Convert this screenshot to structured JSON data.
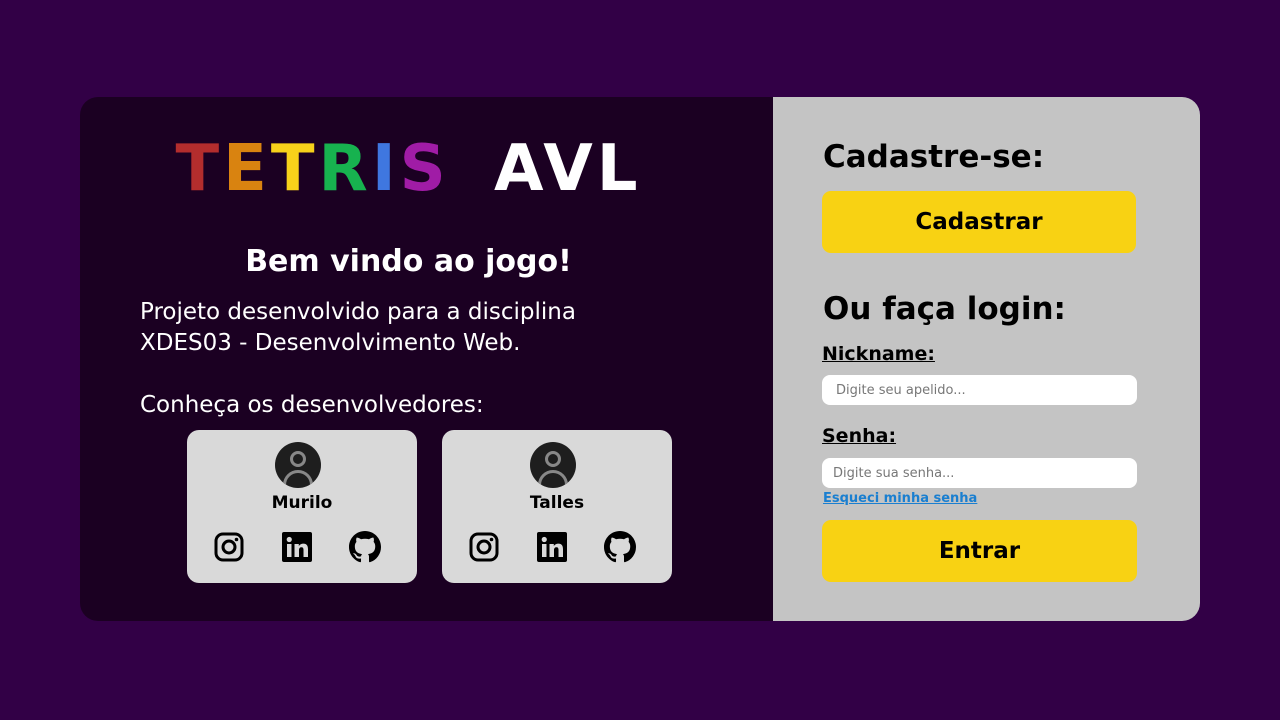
{
  "logo": {
    "letters": [
      {
        "char": "T",
        "color": "#b32d2d"
      },
      {
        "char": "E",
        "color": "#d98310"
      },
      {
        "char": "T",
        "color": "#f7d11a"
      },
      {
        "char": "R",
        "color": "#17b24f"
      },
      {
        "char": "I",
        "color": "#3f77e0"
      },
      {
        "char": "S",
        "color": "#a01ca6"
      }
    ],
    "suffix": "AVL",
    "suffix_color": "#ffffff"
  },
  "welcome": "Bem vindo ao jogo!",
  "description_line1": "Projeto desenvolvido para a disciplina",
  "description_line2": "XDES03 - Desenvolvimento Web.",
  "developers_title": "Conheça os desenvolvedores:",
  "developers": [
    {
      "name": "Murilo",
      "icons": [
        "instagram-icon",
        "linkedin-icon",
        "github-icon"
      ]
    },
    {
      "name": "Talles",
      "icons": [
        "instagram-icon",
        "linkedin-icon",
        "github-icon"
      ]
    }
  ],
  "signup": {
    "title": "Cadastre-se:",
    "button_label": "Cadastrar"
  },
  "login": {
    "title": "Ou faça login:",
    "nickname_label": "Nickname:",
    "nickname_placeholder": "Digite seu apelido...",
    "password_label": "Senha:",
    "password_placeholder": "Digite sua senha...",
    "forgot_link": "Esqueci minha senha",
    "submit_label": "Entrar"
  },
  "colors": {
    "page_bg": "#320046",
    "left_panel_bg": "#1b0022",
    "right_panel_bg": "#c4c4c4",
    "button_accent": "#f8d213",
    "link": "#1a7fd0"
  }
}
